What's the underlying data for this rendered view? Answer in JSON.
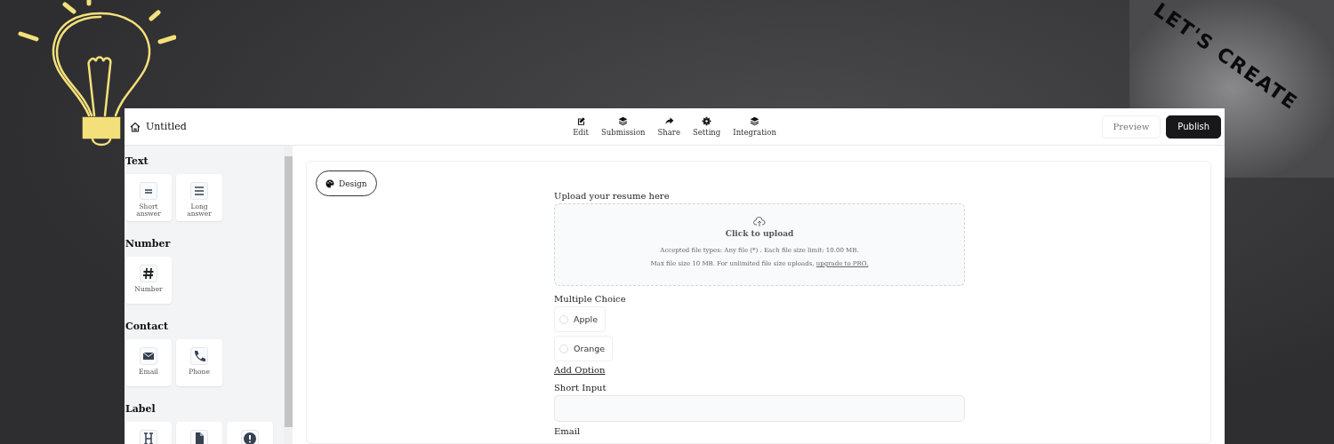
{
  "banner": {
    "slogan": "LET'S CREATE"
  },
  "window": {
    "title": "Untitled"
  },
  "nav": [
    {
      "label": "Edit",
      "kind": "edit",
      "selected": false
    },
    {
      "label": "Submission",
      "kind": "layers",
      "selected": false
    },
    {
      "label": "Share",
      "kind": "share",
      "selected": false
    },
    {
      "label": "Setting",
      "kind": "gear",
      "selected": false
    },
    {
      "label": "Integration",
      "kind": "layers",
      "selected": false
    }
  ],
  "header_buttons": [
    {
      "label": "Preview",
      "kind": "secondary"
    },
    {
      "label": "Publish",
      "kind": "primary"
    }
  ],
  "sidebar": {
    "sections": [
      {
        "title": "Text",
        "items": [
          {
            "label": "Short answer",
            "kind": "short"
          },
          {
            "label": "Long answer",
            "kind": "long"
          }
        ]
      },
      {
        "title": "Number",
        "items": [
          {
            "label": "Number",
            "kind": "hash"
          }
        ]
      },
      {
        "title": "Contact",
        "items": [
          {
            "label": "Email",
            "kind": "mail"
          },
          {
            "label": "Phone",
            "kind": "phone"
          }
        ]
      },
      {
        "title": "Label",
        "items": [
          {
            "kind": "heading"
          },
          {
            "kind": "file"
          },
          {
            "kind": "alert"
          }
        ]
      }
    ]
  },
  "design_button": "Design",
  "form": {
    "upload": {
      "label": "Upload your resume here",
      "action": "Click to upload",
      "note": "Accepted file types: Any file (*) . Each file size limit: 10.00 MB.",
      "limit": "Max file size 10 MB. For unlimited file size uploads,",
      "link": "upgrade to PRO."
    },
    "choice": {
      "label": "Multiple Choice",
      "options": [
        {
          "label": "Apple",
          "selected": false
        },
        {
          "label": "Orange",
          "selected": false
        }
      ],
      "add": "Add Option"
    },
    "short_input": {
      "label": "Short Input"
    },
    "email": {
      "label": "Email"
    }
  }
}
